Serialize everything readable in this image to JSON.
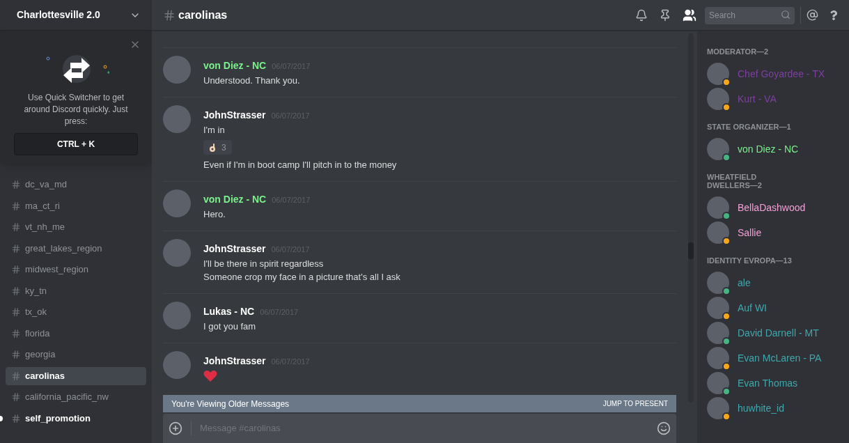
{
  "server": {
    "name": "Charlottesville 2.0"
  },
  "quick_switcher": {
    "text": "Use Quick Switcher to get around Discord quickly. Just press:",
    "shortcut": "CTRL + K"
  },
  "channels": [
    {
      "name": "dc_va_md",
      "selected": false,
      "unread": false
    },
    {
      "name": "ma_ct_ri",
      "selected": false,
      "unread": false
    },
    {
      "name": "vt_nh_me",
      "selected": false,
      "unread": false
    },
    {
      "name": "great_lakes_region",
      "selected": false,
      "unread": false
    },
    {
      "name": "midwest_region",
      "selected": false,
      "unread": false
    },
    {
      "name": "ky_tn",
      "selected": false,
      "unread": false
    },
    {
      "name": "tx_ok",
      "selected": false,
      "unread": false
    },
    {
      "name": "florida",
      "selected": false,
      "unread": false
    },
    {
      "name": "georgia",
      "selected": false,
      "unread": false
    },
    {
      "name": "carolinas",
      "selected": true,
      "unread": false
    },
    {
      "name": "california_pacific_nw",
      "selected": false,
      "unread": false
    },
    {
      "name": "self_promotion",
      "selected": false,
      "unread": true
    }
  ],
  "header": {
    "channel": "carolinas",
    "search_placeholder": "Search"
  },
  "messages": [
    {
      "author": "von Diez - NC",
      "color": "#7bf08d",
      "time": "06/07/2017",
      "lines": [
        {
          "kind": "text",
          "text": "Understood. Thank you."
        }
      ]
    },
    {
      "author": "JohnStrasser",
      "color": "#ffffff",
      "time": "06/07/2017",
      "lines": [
        {
          "kind": "text",
          "text": "I'm in"
        },
        {
          "kind": "reaction",
          "count": "3"
        },
        {
          "kind": "text",
          "text": "Even if I'm in boot camp I'll pitch in to the money"
        }
      ]
    },
    {
      "author": "von Diez - NC",
      "color": "#7bf08d",
      "time": "06/07/2017",
      "lines": [
        {
          "kind": "text",
          "text": "Hero."
        }
      ]
    },
    {
      "author": "JohnStrasser",
      "color": "#ffffff",
      "time": "06/07/2017",
      "lines": [
        {
          "kind": "text",
          "text": "I'll be there in spirit regardless"
        },
        {
          "kind": "text",
          "text": "Someone crop my face in a picture that's all I ask"
        }
      ]
    },
    {
      "author": "Lukas - NC",
      "color": "#ffffff",
      "time": "06/07/2017",
      "lines": [
        {
          "kind": "text",
          "text": "I got you fam"
        }
      ]
    },
    {
      "author": "JohnStrasser",
      "color": "#ffffff",
      "time": "06/07/2017",
      "lines": [
        {
          "kind": "heart"
        }
      ]
    }
  ],
  "older_bar": {
    "text": "You're Viewing Older Messages",
    "action": "JUMP TO PRESENT"
  },
  "composer": {
    "placeholder": "Message #carolinas"
  },
  "member_groups": [
    {
      "title": "MODERATOR—2",
      "members": [
        {
          "name": "Chef Goyardee - TX",
          "color": "#7e3fa0",
          "idle": true
        },
        {
          "name": "Kurt - VA",
          "color": "#7e3fa0",
          "idle": true
        }
      ]
    },
    {
      "title": "STATE ORGANIZER—1",
      "members": [
        {
          "name": "von Diez - NC",
          "color": "#7bf08d",
          "idle": false
        }
      ]
    },
    {
      "title": "WHEATFIELD DWELLERS—2",
      "members": [
        {
          "name": "BellaDashwood",
          "color": "#f3a0d7",
          "idle": false
        },
        {
          "name": "Sallie",
          "color": "#f3a0d7",
          "idle": true
        }
      ]
    },
    {
      "title": "IDENTITY EVROPA—13",
      "members": [
        {
          "name": "ale",
          "color": "#3fa8ad",
          "idle": false
        },
        {
          "name": "Auf WI",
          "color": "#3fa8ad",
          "idle": true
        },
        {
          "name": "David Darnell - MT",
          "color": "#3fa8ad",
          "idle": false
        },
        {
          "name": "Evan McLaren - PA",
          "color": "#3fa8ad",
          "idle": true
        },
        {
          "name": "Evan Thomas",
          "color": "#3fa8ad",
          "idle": false
        },
        {
          "name": "huwhite_id",
          "color": "#3fa8ad",
          "idle": true
        }
      ]
    }
  ]
}
